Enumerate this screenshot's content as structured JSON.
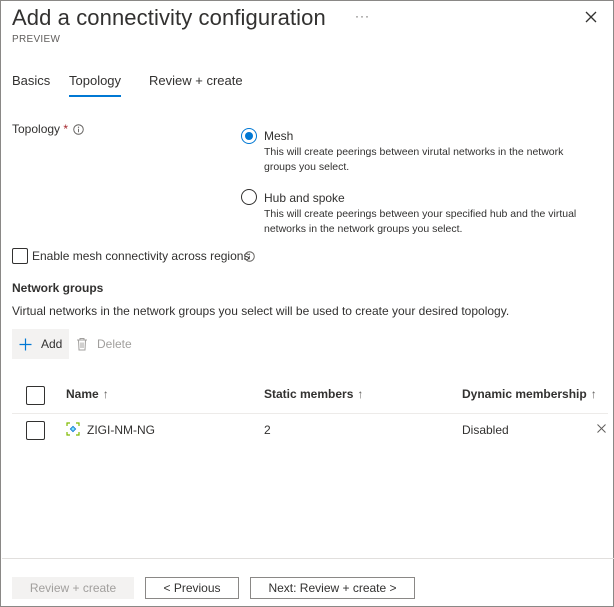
{
  "header": {
    "title": "Add a connectivity configuration",
    "more_label": "···",
    "subtitle": "PREVIEW"
  },
  "tabs": [
    {
      "label": "Basics",
      "active": false
    },
    {
      "label": "Topology",
      "active": true
    },
    {
      "label": "Review + create",
      "active": false
    }
  ],
  "topology": {
    "label": "Topology",
    "required_mark": "*",
    "options": [
      {
        "label": "Mesh",
        "description": "This will create peerings between virutal networks in the network groups you select.",
        "selected": true
      },
      {
        "label": "Hub and spoke",
        "description": "This will create peerings between your specified hub and the virtual networks in the network groups you select.",
        "selected": false
      }
    ]
  },
  "mesh_regions": {
    "label": "Enable mesh connectivity across regions",
    "checked": false
  },
  "network_groups": {
    "title": "Network groups",
    "description": "Virtual networks in the network groups you select will be used to create your desired topology.",
    "add_label": "Add",
    "delete_label": "Delete",
    "columns": [
      {
        "label": "Name",
        "sort": "↑"
      },
      {
        "label": "Static members",
        "sort": "↑"
      },
      {
        "label": "Dynamic membership",
        "sort": "↑"
      }
    ],
    "rows": [
      {
        "name": "ZIGI-NM-NG",
        "static_members": "2",
        "dynamic_membership": "Disabled"
      }
    ]
  },
  "footer": {
    "review_create_label": "Review + create",
    "previous_label": "< Previous",
    "next_label": "Next: Review + create >"
  },
  "colors": {
    "accent": "#0078d4",
    "required": "#a4262c",
    "disabled_text": "#a19f9d"
  }
}
